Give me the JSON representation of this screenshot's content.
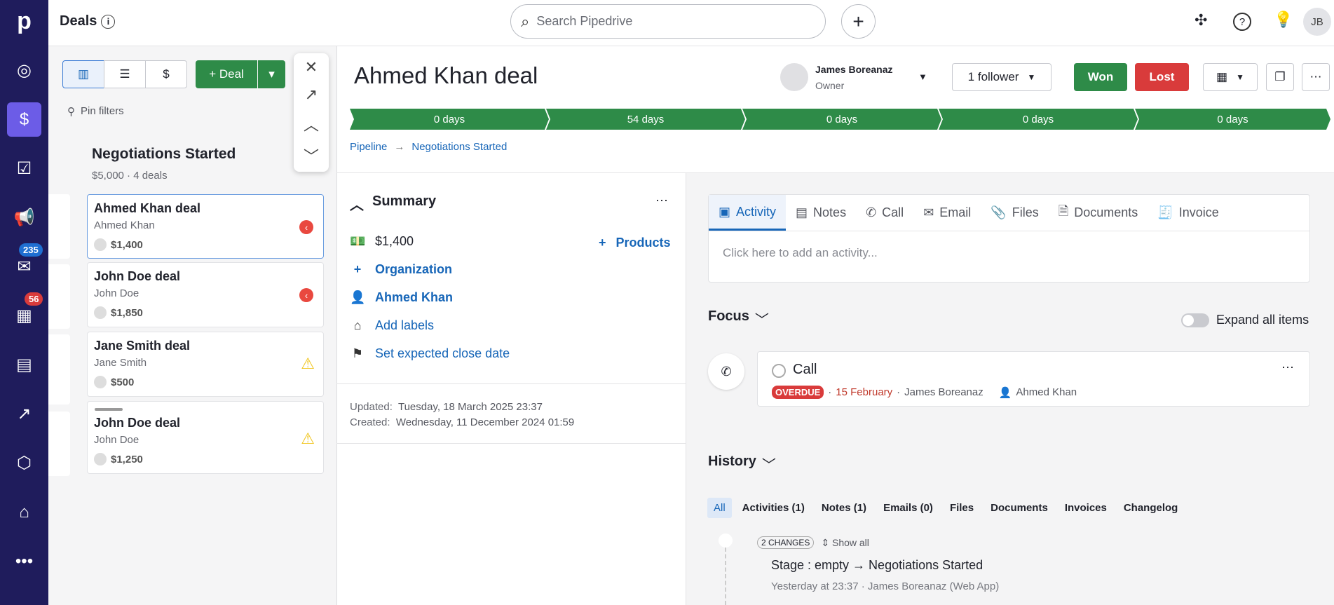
{
  "sidebar": {
    "logo": "p",
    "mail_badge": "235",
    "calendar_badge": "56",
    "colors": {
      "bg": "#1f1c5c",
      "active": "#6c5ce7"
    }
  },
  "topbar": {
    "title": "Deals",
    "search_placeholder": "Search Pipedrive",
    "avatar": "JB"
  },
  "pipeline": {
    "add_deal": "+ Deal",
    "pin_filters": "Pin filters",
    "column": {
      "title": "Negotiations Started",
      "summary": "$5,000 · 4 deals"
    },
    "cards": [
      {
        "title": "Ahmed Khan deal",
        "person": "Ahmed Khan",
        "value": "$1,400",
        "status": "overdue"
      },
      {
        "title": "John Doe deal",
        "person": "John Doe",
        "value": "$1,850",
        "status": "overdue"
      },
      {
        "title": "Jane Smith deal",
        "person": "Jane Smith",
        "value": "$500",
        "status": "warning"
      },
      {
        "title": "John Doe deal",
        "person": "John Doe",
        "value": "$1,250",
        "status": "warning"
      }
    ]
  },
  "deal": {
    "title": "Ahmed Khan deal",
    "owner_name": "James Boreanaz",
    "owner_role": "Owner",
    "followers": "1 follower",
    "won": "Won",
    "lost": "Lost",
    "stages": [
      "0 days",
      "54 days",
      "0 days",
      "0 days",
      "0 days"
    ],
    "breadcrumb": [
      "Pipeline",
      "Negotiations Started"
    ],
    "summary": {
      "title": "Summary",
      "value": "$1,400",
      "products": "Products",
      "organization": "Organization",
      "person": "Ahmed Khan",
      "labels": "Add labels",
      "close_date": "Set expected close date",
      "updated_label": "Updated:",
      "updated": "Tuesday, 18 March 2025 23:37",
      "created_label": "Created:",
      "created": "Wednesday, 11 December 2024 01:59"
    }
  },
  "composer": {
    "tabs": [
      "Activity",
      "Notes",
      "Call",
      "Email",
      "Files",
      "Documents",
      "Invoice"
    ],
    "placeholder": "Click here to add an activity..."
  },
  "focus": {
    "title": "Focus",
    "expand": "Expand all items",
    "activity": {
      "title": "Call",
      "badge": "OVERDUE",
      "date": "15 February",
      "owner": "James Boreanaz",
      "person": "Ahmed Khan"
    }
  },
  "history": {
    "title": "History",
    "filters": [
      "All",
      "Activities (1)",
      "Notes (1)",
      "Emails (0)",
      "Files",
      "Documents",
      "Invoices",
      "Changelog"
    ],
    "changes": "2 CHANGES",
    "show_all": "Show all",
    "entry": "Stage : empty → Negotiations Started",
    "meta": "Yesterday at 23:37 · James Boreanaz (Web App)"
  },
  "colors": {
    "green": "#2e8b48",
    "red": "#d93b3b",
    "link": "#1766b8"
  }
}
